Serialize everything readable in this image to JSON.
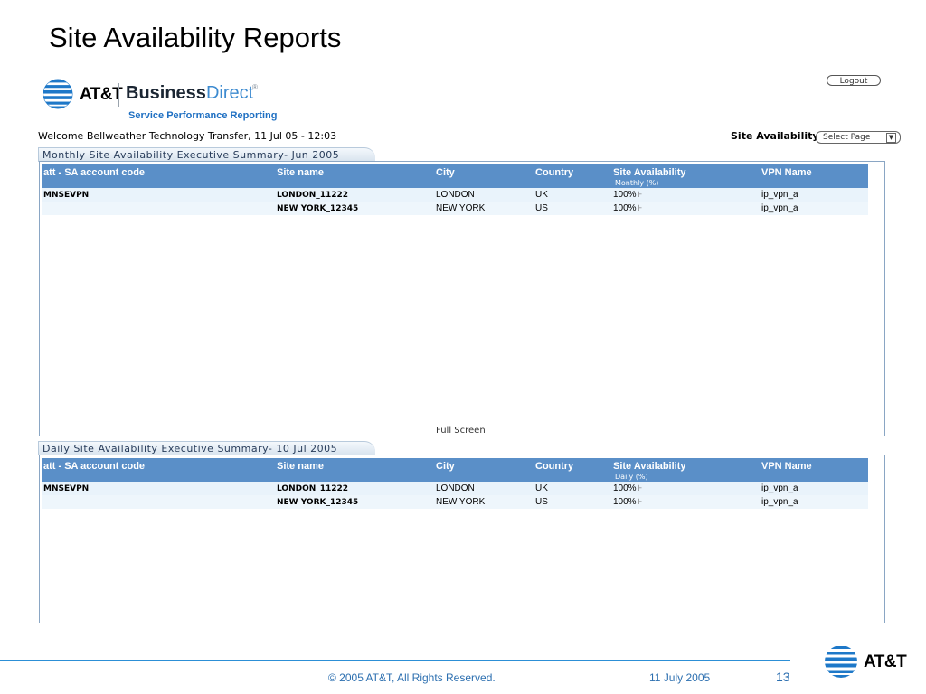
{
  "slide_title": "Site Availability Reports",
  "logo": {
    "brand": "AT&T",
    "product_bold": "Business",
    "product_light": "Direct",
    "reg": "®",
    "subtitle": "Service Performance Reporting"
  },
  "logout_label": "Logout",
  "welcome_text": "Welcome Bellweather Technology Transfer,  11 Jul 05 - 12:03",
  "site_availability_label": "Site Availability",
  "select_page_label": "Select Page",
  "monthly": {
    "tab_title": "Monthly Site Availability Executive Summary- Jun 2005",
    "headers": [
      "att - SA account code",
      "Site name",
      "City",
      "Country",
      "Site Availability",
      "VPN Name"
    ],
    "availability_sub": "Monthly  (%)",
    "rows": [
      {
        "account": "MNSEVPN",
        "site": "LONDON_11222",
        "city": "LONDON",
        "country": "UK",
        "availability": "100%",
        "vpn": "ip_vpn_a"
      },
      {
        "account": "",
        "site": "NEW YORK_12345",
        "city": "NEW YORK",
        "country": "US",
        "availability": "100%",
        "vpn": "ip_vpn_a"
      }
    ],
    "full_screen": "Full Screen"
  },
  "daily": {
    "tab_title": "Daily Site Availability Executive Summary- 10 Jul 2005",
    "headers": [
      "att - SA account code",
      "Site name",
      "City",
      "Country",
      "Site Availability",
      "VPN Name"
    ],
    "availability_sub": "Daily  (%)",
    "rows": [
      {
        "account": "MNSEVPN",
        "site": "LONDON_11222",
        "city": "LONDON",
        "country": "UK",
        "availability": "100%",
        "vpn": "ip_vpn_a"
      },
      {
        "account": "",
        "site": "NEW YORK_12345",
        "city": "NEW YORK",
        "country": "US",
        "availability": "100%",
        "vpn": "ip_vpn_a"
      }
    ]
  },
  "footer": {
    "copyright": "© 2005 AT&T, All Rights Reserved.",
    "date": "11 July 2005",
    "page": "13",
    "brand": "AT&T"
  },
  "colors": {
    "header_blue": "#5a8fc8",
    "row_bg": "#e9f3fb",
    "footer_blue": "#2c8fd6",
    "link_blue": "#1e6fc2"
  }
}
